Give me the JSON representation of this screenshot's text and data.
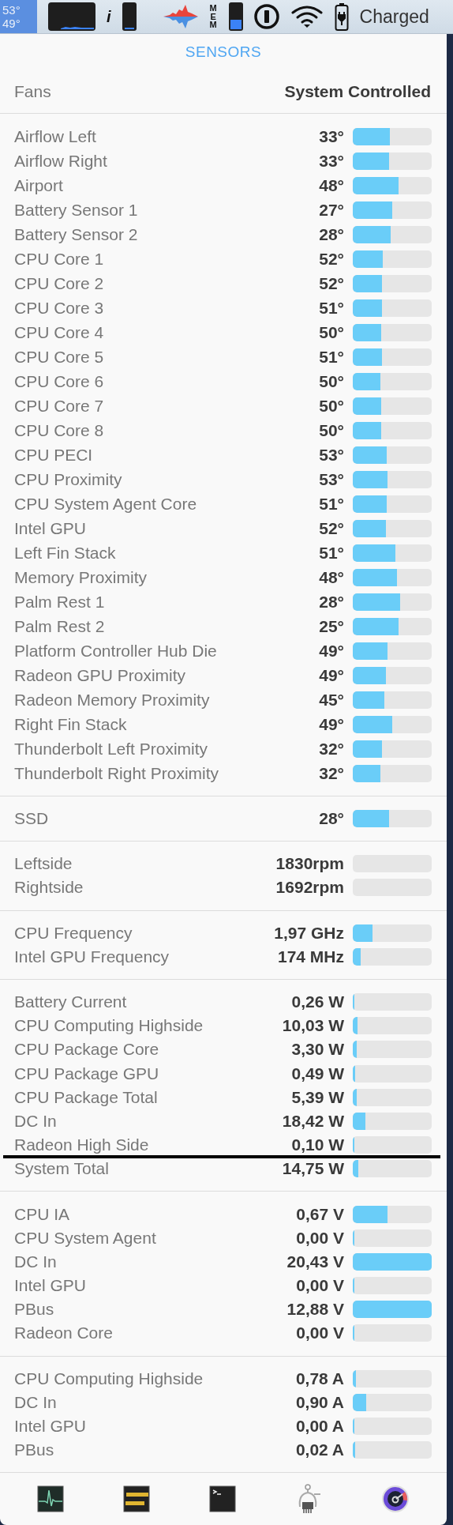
{
  "menu_bar": {
    "temps": [
      "53°",
      "49°"
    ],
    "info_label": "i",
    "mem_label": "MEM",
    "battery_status": "Charged"
  },
  "header": "SENSORS",
  "fans": {
    "label": "Fans",
    "value": "System Controlled"
  },
  "groups": [
    {
      "rows": [
        {
          "name": "Airflow Left",
          "value": "33°",
          "level": 0.47
        },
        {
          "name": "Airflow Right",
          "value": "33°",
          "level": 0.46
        },
        {
          "name": "Airport",
          "value": "48°",
          "level": 0.58
        },
        {
          "name": "Battery Sensor 1",
          "value": "27°",
          "level": 0.5
        },
        {
          "name": "Battery Sensor 2",
          "value": "28°",
          "level": 0.48
        },
        {
          "name": "CPU Core 1",
          "value": "52°",
          "level": 0.38
        },
        {
          "name": "CPU Core 2",
          "value": "52°",
          "level": 0.37
        },
        {
          "name": "CPU Core 3",
          "value": "51°",
          "level": 0.37
        },
        {
          "name": "CPU Core 4",
          "value": "50°",
          "level": 0.36
        },
        {
          "name": "CPU Core 5",
          "value": "51°",
          "level": 0.37
        },
        {
          "name": "CPU Core 6",
          "value": "50°",
          "level": 0.35
        },
        {
          "name": "CPU Core 7",
          "value": "50°",
          "level": 0.36
        },
        {
          "name": "CPU Core 8",
          "value": "50°",
          "level": 0.36
        },
        {
          "name": "CPU PECI",
          "value": "53°",
          "level": 0.43
        },
        {
          "name": "CPU Proximity",
          "value": "53°",
          "level": 0.44
        },
        {
          "name": "CPU System Agent Core",
          "value": "51°",
          "level": 0.43
        },
        {
          "name": "Intel GPU",
          "value": "52°",
          "level": 0.42
        },
        {
          "name": "Left Fin Stack",
          "value": "51°",
          "level": 0.54
        },
        {
          "name": "Memory Proximity",
          "value": "48°",
          "level": 0.56
        },
        {
          "name": "Palm Rest 1",
          "value": "28°",
          "level": 0.6
        },
        {
          "name": "Palm Rest 2",
          "value": "25°",
          "level": 0.58
        },
        {
          "name": "Platform Controller Hub Die",
          "value": "49°",
          "level": 0.44
        },
        {
          "name": "Radeon GPU Proximity",
          "value": "49°",
          "level": 0.42
        },
        {
          "name": "Radeon Memory Proximity",
          "value": "45°",
          "level": 0.4
        },
        {
          "name": "Right Fin Stack",
          "value": "49°",
          "level": 0.5
        },
        {
          "name": "Thunderbolt Left Proximity",
          "value": "32°",
          "level": 0.37
        },
        {
          "name": "Thunderbolt Right Proximity",
          "value": "32°",
          "level": 0.35
        }
      ]
    },
    {
      "rows": [
        {
          "name": "SSD",
          "value": "28°",
          "level": 0.46
        }
      ]
    },
    {
      "rows": [
        {
          "name": "Leftside",
          "value": "1830rpm"
        },
        {
          "name": "Rightside",
          "value": "1692rpm"
        }
      ]
    },
    {
      "rows": [
        {
          "name": "CPU Frequency",
          "value": "1,97 GHz",
          "level": 0.25
        },
        {
          "name": "Intel GPU Frequency",
          "value": "174 MHz",
          "level": 0.1
        }
      ]
    },
    {
      "rows": [
        {
          "name": "Battery Current",
          "value": "0,26 W",
          "level": 0.02,
          "rule_below": false
        },
        {
          "name": "CPU Computing Highside",
          "value": "10,03 W",
          "level": 0.06,
          "rule_below": false
        },
        {
          "name": "CPU Package Core",
          "value": "3,30 W",
          "level": 0.05,
          "rule_below": false
        },
        {
          "name": "CPU Package GPU",
          "value": "0,49 W",
          "level": 0.03,
          "rule_below": false
        },
        {
          "name": "CPU Package Total",
          "value": "5,39 W",
          "level": 0.05,
          "rule_below": false
        },
        {
          "name": "DC In",
          "value": "18,42 W",
          "level": 0.16,
          "rule_below": false
        },
        {
          "name": "Radeon High Side",
          "value": "0,10 W",
          "level": 0.02,
          "rule_below": true
        },
        {
          "name": "System Total",
          "value": "14,75 W",
          "level": 0.07,
          "rule_below": false
        }
      ]
    },
    {
      "rows": [
        {
          "name": "CPU IA",
          "value": "0,67 V",
          "level": 0.44
        },
        {
          "name": "CPU System Agent",
          "value": "0,00 V",
          "level": 0.02
        },
        {
          "name": "DC In",
          "value": "20,43 V",
          "level": 1
        },
        {
          "name": "Intel GPU",
          "value": "0,00 V",
          "level": 0.02
        },
        {
          "name": "PBus",
          "value": "12,88 V",
          "level": 1
        },
        {
          "name": "Radeon Core",
          "value": "0,00 V",
          "level": 0.02
        }
      ]
    },
    {
      "rows": [
        {
          "name": "CPU Computing Highside",
          "value": "0,78 A",
          "level": 0.04
        },
        {
          "name": "DC In",
          "value": "0,90 A",
          "level": 0.17
        },
        {
          "name": "Intel GPU",
          "value": "0,00 A",
          "level": 0.02
        },
        {
          "name": "PBus",
          "value": "0,02 A",
          "level": 0.03
        }
      ]
    }
  ]
}
